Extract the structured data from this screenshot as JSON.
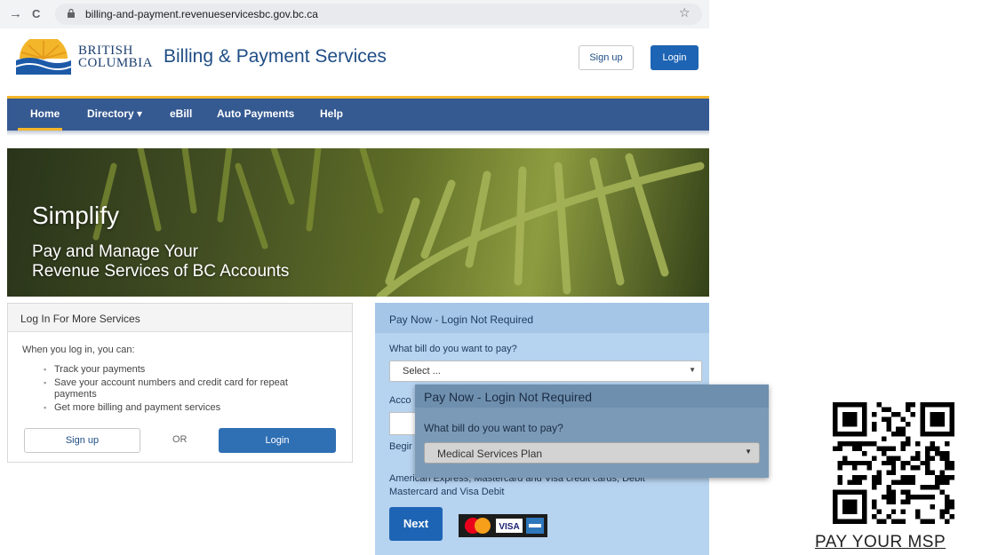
{
  "browser": {
    "back_icon": "back-arrow-icon",
    "back_glyph": "→",
    "reload_glyph": "C",
    "url": "billing-and-payment.revenueservicesbc.gov.bc.ca",
    "star_glyph": "☆"
  },
  "header": {
    "logo_line1": "BRITISH",
    "logo_line2": "COLUMBIA",
    "title": "Billing & Payment Services",
    "signup_label": "Sign up",
    "login_label": "Login"
  },
  "nav": {
    "items": [
      {
        "label": "Home"
      },
      {
        "label": "Directory ▾"
      },
      {
        "label": "eBill"
      },
      {
        "label": "Auto Payments"
      },
      {
        "label": "Help"
      }
    ]
  },
  "hero": {
    "heading": "Simplify",
    "subline1": "Pay and Manage Your",
    "subline2": "Revenue Services of BC Accounts"
  },
  "login_panel": {
    "title": "Log In For More Services",
    "intro": "When you log in, you can:",
    "bullets": [
      "Track your payments",
      "Save your account numbers and credit card for repeat payments",
      "Get more billing and payment services"
    ],
    "signup_label": "Sign up",
    "or_label": "OR",
    "login_label": "Login"
  },
  "pay_panel": {
    "title": "Pay Now - Login Not Required",
    "question": "What bill do you want to pay?",
    "select_value": "Select ...",
    "account_label": "Acco",
    "begin_label": "Begir",
    "cards_text": "American Express, Mastercard and Visa credit cards, Debit Mastercard and Visa Debit",
    "next_label": "Next",
    "visa_label": "VISA"
  },
  "overlay": {
    "title": "Pay Now - Login Not Required",
    "question": "What bill do you want to pay?",
    "select_value": "Medical Services Plan"
  },
  "qr": {
    "caption": "PAY YOUR MSP"
  },
  "colors": {
    "nav_bg": "#355991",
    "gold_accent": "#f3b52a",
    "login_blue": "#1e64b4",
    "pay_panel_bg": "#b6d3ef"
  }
}
